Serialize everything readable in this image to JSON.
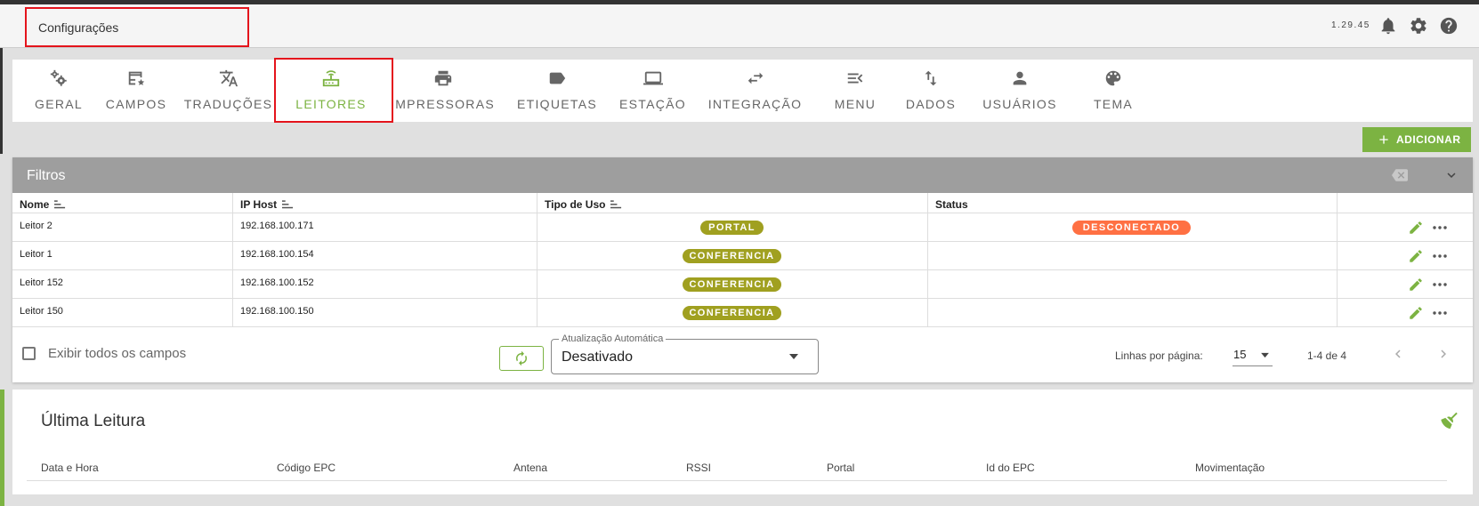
{
  "header": {
    "title": "Configurações",
    "version": "1.29.45"
  },
  "tabs": [
    {
      "label": "GERAL",
      "icon": "gears-icon",
      "active": false
    },
    {
      "label": "CAMPOS",
      "icon": "table-fields-icon",
      "active": false
    },
    {
      "label": "TRADUÇÕES",
      "icon": "translate-icon",
      "active": false
    },
    {
      "label": "LEITORES",
      "icon": "router-icon",
      "active": true
    },
    {
      "label": "IMPRESSORAS",
      "icon": "printer-icon",
      "active": false
    },
    {
      "label": "ETIQUETAS",
      "icon": "label-icon",
      "active": false
    },
    {
      "label": "ESTAÇÃO",
      "icon": "laptop-icon",
      "active": false
    },
    {
      "label": "INTEGRAÇÃO",
      "icon": "swap-arrows-icon",
      "active": false
    },
    {
      "label": "MENU",
      "icon": "menu-open-icon",
      "active": false
    },
    {
      "label": "DADOS",
      "icon": "import-export-icon",
      "active": false
    },
    {
      "label": "USUÁRIOS",
      "icon": "person-icon",
      "active": false
    },
    {
      "label": "TEMA",
      "icon": "palette-icon",
      "active": false
    }
  ],
  "actions": {
    "add_label": "ADICIONAR"
  },
  "filters": {
    "title": "Filtros"
  },
  "table": {
    "columns": [
      "Nome",
      "IP Host",
      "Tipo de Uso",
      "Status"
    ],
    "rows": [
      {
        "nome": "Leitor 2",
        "ip": "192.168.100.171",
        "tipo": "PORTAL",
        "status": "DESCONECTADO"
      },
      {
        "nome": "Leitor 1",
        "ip": "192.168.100.154",
        "tipo": "CONFERENCIA",
        "status": ""
      },
      {
        "nome": "Leitor 152",
        "ip": "192.168.100.152",
        "tipo": "CONFERENCIA",
        "status": ""
      },
      {
        "nome": "Leitor 150",
        "ip": "192.168.100.150",
        "tipo": "CONFERENCIA",
        "status": ""
      }
    ]
  },
  "footer": {
    "show_all_label": "Exibir todos os campos",
    "auto_update_label": "Atualização Automática",
    "auto_update_value": "Desativado",
    "rows_per_page_label": "Linhas por página:",
    "rows_per_page_value": "15",
    "page_info": "1-4 de 4"
  },
  "last_reading": {
    "title": "Última Leitura",
    "columns": [
      "Data e Hora",
      "Código EPC",
      "Antena",
      "RSSI",
      "Portal",
      "Id do EPC",
      "Movimentação"
    ]
  },
  "colors": {
    "accent": "#7cb342",
    "badge_olive": "#a0a020",
    "badge_error": "#ff7043",
    "highlight": "#e4141c"
  }
}
